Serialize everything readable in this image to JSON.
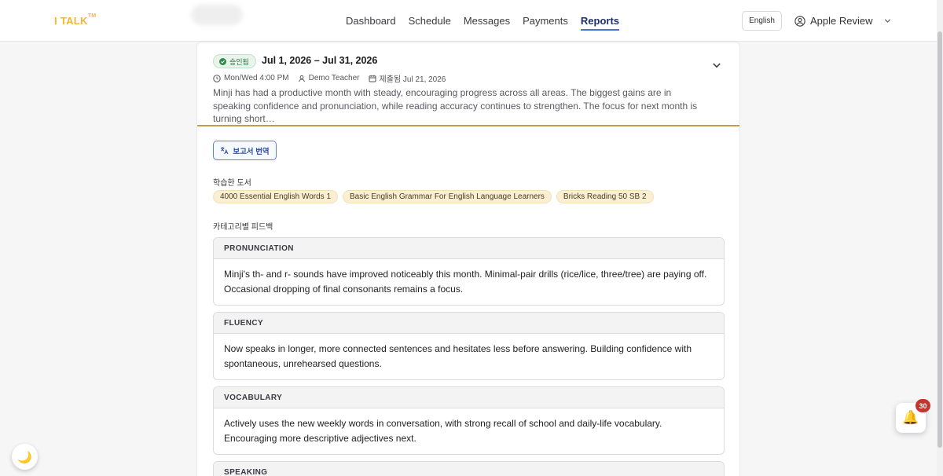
{
  "header": {
    "logo": "I TALK",
    "logo_tm": "TM",
    "nav": [
      "Dashboard",
      "Schedule",
      "Messages",
      "Payments",
      "Reports"
    ],
    "active_nav": "Reports",
    "language": "English",
    "user_name": "Apple Review"
  },
  "report": {
    "status": "승인됨",
    "date_range": "Jul 1, 2026 – Jul 31, 2026",
    "schedule": "Mon/Wed 4:00 PM",
    "teacher": "Demo Teacher",
    "submitted": "제출됨 Jul 21, 2026",
    "excerpt": "Minji has had a productive month with steady, encouraging progress across all areas. The biggest gains are in speaking confidence and pronunciation, while reading accuracy continues to strengthen. The focus for next month is turning short…",
    "translate_label": "보고서 번역",
    "books_label": "학습한 도서",
    "books": [
      "4000 Essential English Words 1",
      "Basic English Grammar For English Language Learners",
      "Bricks Reading 50 SB 2"
    ],
    "feedback_label": "카테고리별 피드백",
    "feedback": [
      {
        "title": "PRONUNCIATION",
        "text": "Minji's th- and r- sounds have improved noticeably this month. Minimal-pair drills (rice/lice, three/tree) are paying off. Occasional dropping of final consonants remains a focus."
      },
      {
        "title": "FLUENCY",
        "text": "Now speaks in longer, more connected sentences and hesitates less before answering. Building confidence with spontaneous, unrehearsed questions."
      },
      {
        "title": "VOCABULARY",
        "text": "Actively uses the new weekly words in conversation, with strong recall of school and daily-life vocabulary. Encouraging more descriptive adjectives next."
      },
      {
        "title": "SPEAKING",
        "text": ""
      }
    ]
  },
  "notifications": {
    "count": "30"
  },
  "colors": {
    "accent": "#4a73d8",
    "logo": "#f2b53a",
    "book_chip": "#fbefd3",
    "status_green": "#2c6e3e"
  }
}
